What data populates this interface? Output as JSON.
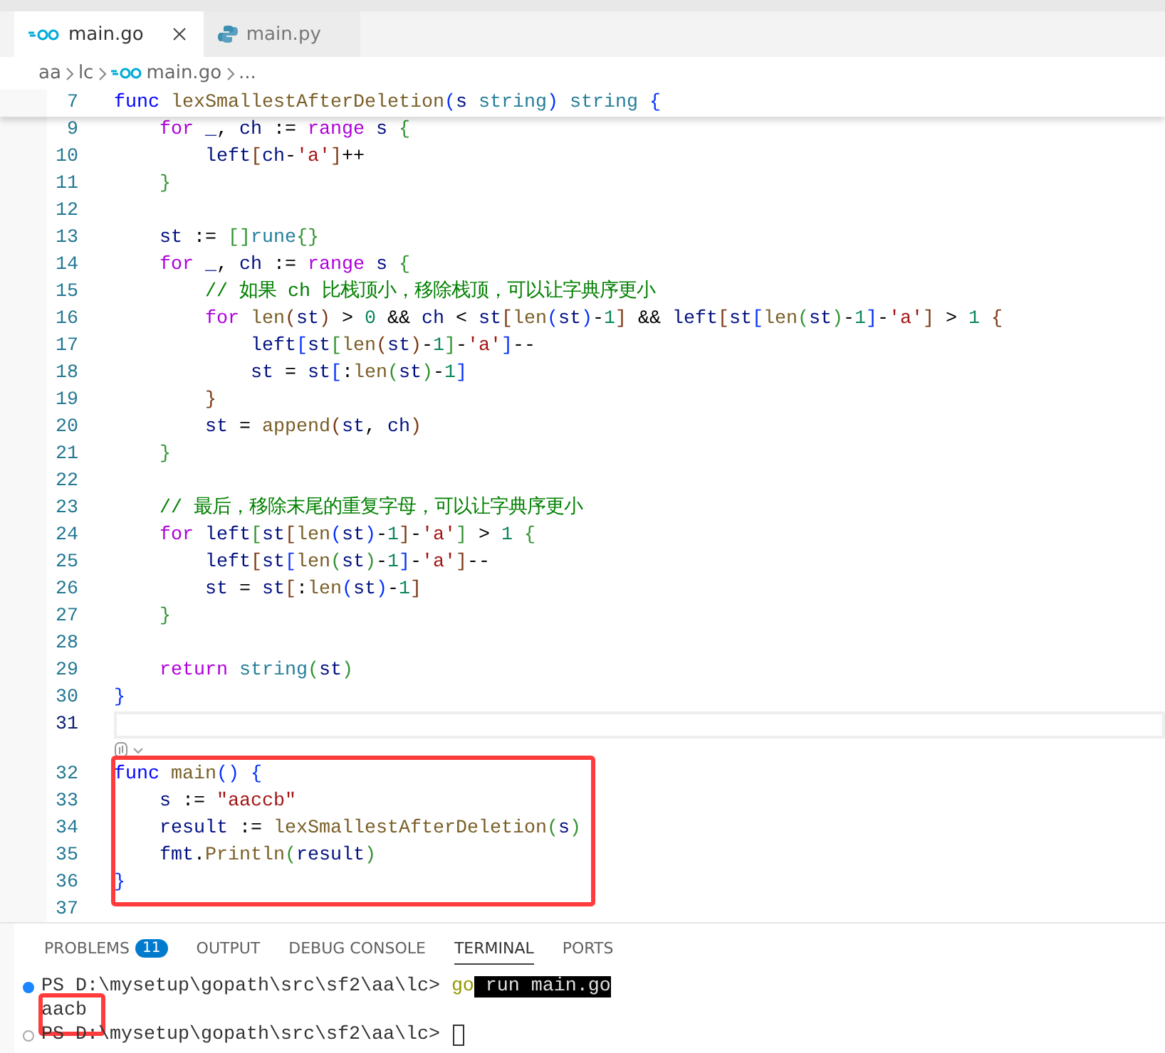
{
  "tabs": [
    {
      "label": "main.go",
      "kind": "go",
      "selected": true
    },
    {
      "label": "main.py",
      "kind": "py",
      "selected": false
    }
  ],
  "breadcrumb": [
    {
      "label": "aa",
      "kind": "folder"
    },
    {
      "label": "lc",
      "kind": "folder"
    },
    {
      "label": "main.go",
      "kind": "go"
    },
    {
      "label": "...",
      "kind": "more"
    }
  ],
  "editor": {
    "sticky_line": {
      "number": "7",
      "tokens": [
        {
          "kind": "kw",
          "text": "func "
        },
        {
          "kind": "fn",
          "text": "lexSmallestAfterDeletion"
        },
        {
          "kind": "b1",
          "text": "("
        },
        {
          "kind": "var",
          "text": "s "
        },
        {
          "kind": "type",
          "text": "string"
        },
        {
          "kind": "b1",
          "text": ")"
        },
        {
          "kind": "type",
          "text": " string "
        },
        {
          "kind": "b1",
          "text": "{"
        }
      ]
    },
    "blocks": [
      {
        "annotated": false,
        "codelens_after": true,
        "lines": [
          {
            "number": "9",
            "current": false,
            "tokens": [
              {
                "kind": "ctl",
                "text": "    for "
              },
              {
                "kind": "var",
                "text": "_"
              },
              {
                "kind": "pl",
                "text": ", "
              },
              {
                "kind": "var",
                "text": "ch"
              },
              {
                "kind": "pl",
                "text": " := "
              },
              {
                "kind": "ctl",
                "text": "range "
              },
              {
                "kind": "var",
                "text": "s "
              },
              {
                "kind": "b2",
                "text": "{"
              }
            ]
          },
          {
            "number": "10",
            "current": false,
            "tokens": [
              {
                "kind": "var",
                "text": "        left"
              },
              {
                "kind": "b3",
                "text": "["
              },
              {
                "kind": "var",
                "text": "ch"
              },
              {
                "kind": "pl",
                "text": "-"
              },
              {
                "kind": "str",
                "text": "'a'"
              },
              {
                "kind": "b3",
                "text": "]"
              },
              {
                "kind": "pl",
                "text": "++"
              }
            ]
          },
          {
            "number": "11",
            "current": false,
            "tokens": [
              {
                "kind": "b2",
                "text": "    }"
              }
            ]
          },
          {
            "number": "12",
            "current": false
          },
          {
            "number": "13",
            "current": false,
            "tokens": [
              {
                "kind": "var",
                "text": "    st"
              },
              {
                "kind": "pl",
                "text": " := "
              },
              {
                "kind": "b2",
                "text": "[]"
              },
              {
                "kind": "type",
                "text": "rune"
              },
              {
                "kind": "b2",
                "text": "{}"
              }
            ]
          },
          {
            "number": "14",
            "current": false,
            "tokens": [
              {
                "kind": "ctl",
                "text": "    for "
              },
              {
                "kind": "var",
                "text": "_"
              },
              {
                "kind": "pl",
                "text": ", "
              },
              {
                "kind": "var",
                "text": "ch"
              },
              {
                "kind": "pl",
                "text": " := "
              },
              {
                "kind": "ctl",
                "text": "range "
              },
              {
                "kind": "var",
                "text": "s "
              },
              {
                "kind": "b2",
                "text": "{"
              }
            ]
          },
          {
            "number": "15",
            "current": false,
            "tokens": [
              {
                "kind": "cm",
                "text": "        // 如果 ch 比栈顶小，移除栈顶，可以让字典序更小"
              }
            ]
          },
          {
            "number": "16",
            "current": false,
            "tokens": [
              {
                "kind": "ctl",
                "text": "        for "
              },
              {
                "kind": "fn",
                "text": "len"
              },
              {
                "kind": "b3",
                "text": "("
              },
              {
                "kind": "var",
                "text": "st"
              },
              {
                "kind": "b3",
                "text": ")"
              },
              {
                "kind": "pl",
                "text": " > "
              },
              {
                "kind": "num",
                "text": "0"
              },
              {
                "kind": "pl",
                "text": " && "
              },
              {
                "kind": "var",
                "text": "ch"
              },
              {
                "kind": "pl",
                "text": " < "
              },
              {
                "kind": "var",
                "text": "st"
              },
              {
                "kind": "b3",
                "text": "["
              },
              {
                "kind": "fn",
                "text": "len"
              },
              {
                "kind": "b1",
                "text": "("
              },
              {
                "kind": "var",
                "text": "st"
              },
              {
                "kind": "b1",
                "text": ")"
              },
              {
                "kind": "pl",
                "text": "-"
              },
              {
                "kind": "num",
                "text": "1"
              },
              {
                "kind": "b3",
                "text": "]"
              },
              {
                "kind": "pl",
                "text": " && "
              },
              {
                "kind": "var",
                "text": "left"
              },
              {
                "kind": "b3",
                "text": "["
              },
              {
                "kind": "var",
                "text": "st"
              },
              {
                "kind": "b1",
                "text": "["
              },
              {
                "kind": "fn",
                "text": "len"
              },
              {
                "kind": "b2",
                "text": "("
              },
              {
                "kind": "var",
                "text": "st"
              },
              {
                "kind": "b2",
                "text": ")"
              },
              {
                "kind": "pl",
                "text": "-"
              },
              {
                "kind": "num",
                "text": "1"
              },
              {
                "kind": "b1",
                "text": "]"
              },
              {
                "kind": "pl",
                "text": "-"
              },
              {
                "kind": "str",
                "text": "'a'"
              },
              {
                "kind": "b3",
                "text": "]"
              },
              {
                "kind": "pl",
                "text": " > "
              },
              {
                "kind": "num",
                "text": "1 "
              },
              {
                "kind": "b3",
                "text": "{"
              }
            ]
          },
          {
            "number": "17",
            "current": false,
            "tokens": [
              {
                "kind": "var",
                "text": "            left"
              },
              {
                "kind": "b1",
                "text": "["
              },
              {
                "kind": "var",
                "text": "st"
              },
              {
                "kind": "b2",
                "text": "["
              },
              {
                "kind": "fn",
                "text": "len"
              },
              {
                "kind": "b3",
                "text": "("
              },
              {
                "kind": "var",
                "text": "st"
              },
              {
                "kind": "b3",
                "text": ")"
              },
              {
                "kind": "pl",
                "text": "-"
              },
              {
                "kind": "num",
                "text": "1"
              },
              {
                "kind": "b2",
                "text": "]"
              },
              {
                "kind": "pl",
                "text": "-"
              },
              {
                "kind": "str",
                "text": "'a'"
              },
              {
                "kind": "b1",
                "text": "]"
              },
              {
                "kind": "pl",
                "text": "--"
              }
            ]
          },
          {
            "number": "18",
            "current": false,
            "tokens": [
              {
                "kind": "var",
                "text": "            st"
              },
              {
                "kind": "pl",
                "text": " = "
              },
              {
                "kind": "var",
                "text": "st"
              },
              {
                "kind": "b1",
                "text": "["
              },
              {
                "kind": "pl",
                "text": ":"
              },
              {
                "kind": "fn",
                "text": "len"
              },
              {
                "kind": "b2",
                "text": "("
              },
              {
                "kind": "var",
                "text": "st"
              },
              {
                "kind": "b2",
                "text": ")"
              },
              {
                "kind": "pl",
                "text": "-"
              },
              {
                "kind": "num",
                "text": "1"
              },
              {
                "kind": "b1",
                "text": "]"
              }
            ]
          },
          {
            "number": "19",
            "current": false,
            "tokens": [
              {
                "kind": "b3",
                "text": "        }"
              }
            ]
          },
          {
            "number": "20",
            "current": false,
            "tokens": [
              {
                "kind": "var",
                "text": "        st"
              },
              {
                "kind": "pl",
                "text": " = "
              },
              {
                "kind": "fn",
                "text": "append"
              },
              {
                "kind": "b3",
                "text": "("
              },
              {
                "kind": "var",
                "text": "st"
              },
              {
                "kind": "pl",
                "text": ", "
              },
              {
                "kind": "var",
                "text": "ch"
              },
              {
                "kind": "b3",
                "text": ")"
              }
            ]
          },
          {
            "number": "21",
            "current": false,
            "tokens": [
              {
                "kind": "b2",
                "text": "    }"
              }
            ]
          },
          {
            "number": "22",
            "current": false
          },
          {
            "number": "23",
            "current": false,
            "tokens": [
              {
                "kind": "cm",
                "text": "    // 最后，移除末尾的重复字母，可以让字典序更小"
              }
            ]
          },
          {
            "number": "24",
            "current": false,
            "tokens": [
              {
                "kind": "ctl",
                "text": "    for "
              },
              {
                "kind": "var",
                "text": "left"
              },
              {
                "kind": "b2",
                "text": "["
              },
              {
                "kind": "var",
                "text": "st"
              },
              {
                "kind": "b3",
                "text": "["
              },
              {
                "kind": "fn",
                "text": "len"
              },
              {
                "kind": "b1",
                "text": "("
              },
              {
                "kind": "var",
                "text": "st"
              },
              {
                "kind": "b1",
                "text": ")"
              },
              {
                "kind": "pl",
                "text": "-"
              },
              {
                "kind": "num",
                "text": "1"
              },
              {
                "kind": "b3",
                "text": "]"
              },
              {
                "kind": "pl",
                "text": "-"
              },
              {
                "kind": "str",
                "text": "'a'"
              },
              {
                "kind": "b2",
                "text": "]"
              },
              {
                "kind": "pl",
                "text": " > "
              },
              {
                "kind": "num",
                "text": "1 "
              },
              {
                "kind": "b2",
                "text": "{"
              }
            ]
          },
          {
            "number": "25",
            "current": false,
            "tokens": [
              {
                "kind": "var",
                "text": "        left"
              },
              {
                "kind": "b3",
                "text": "["
              },
              {
                "kind": "var",
                "text": "st"
              },
              {
                "kind": "b1",
                "text": "["
              },
              {
                "kind": "fn",
                "text": "len"
              },
              {
                "kind": "b2",
                "text": "("
              },
              {
                "kind": "var",
                "text": "st"
              },
              {
                "kind": "b2",
                "text": ")"
              },
              {
                "kind": "pl",
                "text": "-"
              },
              {
                "kind": "num",
                "text": "1"
              },
              {
                "kind": "b1",
                "text": "]"
              },
              {
                "kind": "pl",
                "text": "-"
              },
              {
                "kind": "str",
                "text": "'a'"
              },
              {
                "kind": "b3",
                "text": "]"
              },
              {
                "kind": "pl",
                "text": "--"
              }
            ]
          },
          {
            "number": "26",
            "current": false,
            "tokens": [
              {
                "kind": "var",
                "text": "        st"
              },
              {
                "kind": "pl",
                "text": " = "
              },
              {
                "kind": "var",
                "text": "st"
              },
              {
                "kind": "b3",
                "text": "["
              },
              {
                "kind": "pl",
                "text": ":"
              },
              {
                "kind": "fn",
                "text": "len"
              },
              {
                "kind": "b1",
                "text": "("
              },
              {
                "kind": "var",
                "text": "st"
              },
              {
                "kind": "b1",
                "text": ")"
              },
              {
                "kind": "pl",
                "text": "-"
              },
              {
                "kind": "num",
                "text": "1"
              },
              {
                "kind": "b3",
                "text": "]"
              }
            ]
          },
          {
            "number": "27",
            "current": false,
            "tokens": [
              {
                "kind": "b2",
                "text": "    }"
              }
            ]
          },
          {
            "number": "28",
            "current": false
          },
          {
            "number": "29",
            "current": false,
            "tokens": [
              {
                "kind": "ctl",
                "text": "    return "
              },
              {
                "kind": "type",
                "text": "string"
              },
              {
                "kind": "b2",
                "text": "("
              },
              {
                "kind": "var",
                "text": "st"
              },
              {
                "kind": "b2",
                "text": ")"
              }
            ]
          },
          {
            "number": "30",
            "current": false,
            "tokens": [
              {
                "kind": "b1",
                "text": "}"
              }
            ]
          },
          {
            "number": "31",
            "current": true
          }
        ]
      },
      {
        "annotated": true,
        "codelens_after": false,
        "lines": [
          {
            "number": "32",
            "current": false,
            "tokens": [
              {
                "kind": "kw",
                "text": "func "
              },
              {
                "kind": "fn",
                "text": "main"
              },
              {
                "kind": "b1",
                "text": "() {"
              }
            ]
          },
          {
            "number": "33",
            "current": false,
            "tokens": [
              {
                "kind": "var",
                "text": "    s"
              },
              {
                "kind": "pl",
                "text": " := "
              },
              {
                "kind": "str",
                "text": "\"aaccb\""
              }
            ]
          },
          {
            "number": "34",
            "current": false,
            "tokens": [
              {
                "kind": "var",
                "text": "    result"
              },
              {
                "kind": "pl",
                "text": " := "
              },
              {
                "kind": "fn",
                "text": "lexSmallestAfterDeletion"
              },
              {
                "kind": "b2",
                "text": "("
              },
              {
                "kind": "var",
                "text": "s"
              },
              {
                "kind": "b2",
                "text": ")"
              }
            ]
          },
          {
            "number": "35",
            "current": false,
            "tokens": [
              {
                "kind": "var",
                "text": "    fmt"
              },
              {
                "kind": "pl",
                "text": "."
              },
              {
                "kind": "fn",
                "text": "Println"
              },
              {
                "kind": "b2",
                "text": "("
              },
              {
                "kind": "var",
                "text": "result"
              },
              {
                "kind": "b2",
                "text": ")"
              }
            ]
          },
          {
            "number": "36",
            "current": false,
            "tokens": [
              {
                "kind": "b1",
                "text": "}"
              }
            ]
          }
        ]
      },
      {
        "annotated": false,
        "codelens_after": false,
        "lines": [
          {
            "number": "37",
            "current": false
          }
        ]
      }
    ]
  },
  "panel": {
    "tabs": [
      {
        "label": "PROBLEMS",
        "badge": "11",
        "selected": false
      },
      {
        "label": "OUTPUT",
        "selected": false
      },
      {
        "label": "DEBUG CONSOLE",
        "selected": false
      },
      {
        "label": "TERMINAL",
        "selected": true
      },
      {
        "label": "PORTS",
        "selected": false
      }
    ],
    "terminal": [
      {
        "kind": "success",
        "annotated": false,
        "cursor": false,
        "segments": [
          {
            "kind": "prompt",
            "text": "PS D:\\mysetup\\gopath\\src\\sf2\\aa\\lc> "
          },
          {
            "kind": "cmd",
            "text": "go"
          },
          {
            "kind": "sel",
            "text": " run main.go"
          }
        ]
      },
      {
        "kind": "output",
        "annotated": true,
        "cursor": false,
        "segments": [
          {
            "kind": "out",
            "text": "aacb"
          }
        ]
      },
      {
        "kind": "pending",
        "annotated": false,
        "cursor": true,
        "segments": [
          {
            "kind": "prompt",
            "text": "PS D:\\mysetup\\gopath\\src\\sf2\\aa\\lc> "
          }
        ]
      }
    ]
  }
}
